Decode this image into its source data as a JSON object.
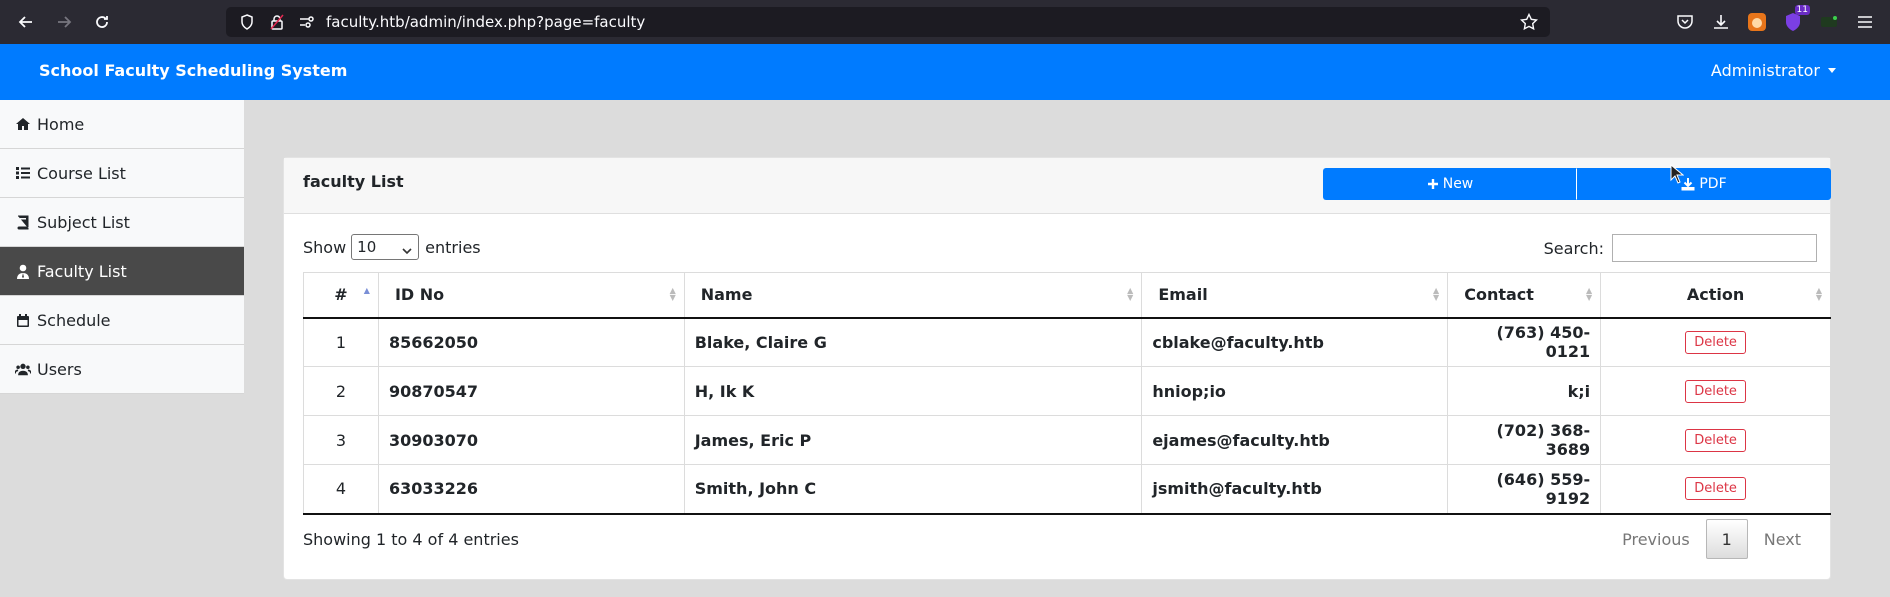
{
  "browser": {
    "url": "faculty.htb/admin/index.php?page=faculty",
    "ext_badge": "11"
  },
  "app": {
    "brand": "School Faculty Scheduling System",
    "user_menu": "Administrator"
  },
  "sidebar": {
    "items": [
      {
        "label": "Home",
        "icon": "home-icon"
      },
      {
        "label": "Course List",
        "icon": "list-icon"
      },
      {
        "label": "Subject List",
        "icon": "book-icon"
      },
      {
        "label": "Faculty List",
        "icon": "user-tie-icon",
        "active": true
      },
      {
        "label": "Schedule",
        "icon": "calendar-icon"
      },
      {
        "label": "Users",
        "icon": "users-icon"
      }
    ]
  },
  "card": {
    "title": "faculty List",
    "new_label": "New",
    "pdf_label": "PDF"
  },
  "table_controls": {
    "show_label": "Show",
    "entries_value": "10",
    "entries_label": "entries",
    "search_label": "Search:"
  },
  "table": {
    "headers": [
      "#",
      "ID No",
      "Name",
      "Email",
      "Contact",
      "Action"
    ],
    "rows": [
      {
        "idx": "1",
        "id_no": "85662050",
        "name": "Blake, Claire G",
        "email": "cblake@faculty.htb",
        "contact": "(763) 450-0121",
        "action": "Delete"
      },
      {
        "idx": "2",
        "id_no": "90870547",
        "name": "H, Ik K",
        "email": "hniop;io",
        "contact": "k;i",
        "action": "Delete"
      },
      {
        "idx": "3",
        "id_no": "30903070",
        "name": "James, Eric P",
        "email": "ejames@faculty.htb",
        "contact": "(702) 368-3689",
        "action": "Delete"
      },
      {
        "idx": "4",
        "id_no": "63033226",
        "name": "Smith, John C",
        "email": "jsmith@faculty.htb",
        "contact": "(646) 559-9192",
        "action": "Delete"
      }
    ]
  },
  "footer": {
    "info": "Showing 1 to 4 of 4 entries",
    "previous": "Previous",
    "current_page": "1",
    "next": "Next"
  },
  "colors": {
    "primary": "#007bff",
    "danger": "#dc3545",
    "sidebar_active": "#494949"
  }
}
